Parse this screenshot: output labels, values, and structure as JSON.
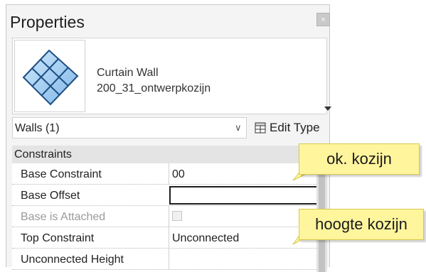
{
  "panel": {
    "title": "Properties",
    "close_label": "×"
  },
  "type_selector": {
    "family": "Curtain Wall",
    "type": "200_31_ontwerpkozijn"
  },
  "filter": {
    "selected": "Walls (1)",
    "edit_type_label": "Edit Type"
  },
  "properties": {
    "section": "Constraints",
    "rows": [
      {
        "label": "Base Constraint",
        "value": "00"
      },
      {
        "label": "Base Offset",
        "value": ""
      },
      {
        "label": "Base is Attached",
        "value": ""
      },
      {
        "label": "Top Constraint",
        "value": "Unconnected"
      },
      {
        "label": "Unconnected Height",
        "value": ""
      }
    ]
  },
  "annotations": {
    "callout_1": "ok. kozijn",
    "callout_2": "hoogte kozijn",
    "color": "#fff59d"
  },
  "icons": [
    "close-icon",
    "curtain-wall-icon",
    "chevron-down-icon",
    "edit-type-icon"
  ]
}
